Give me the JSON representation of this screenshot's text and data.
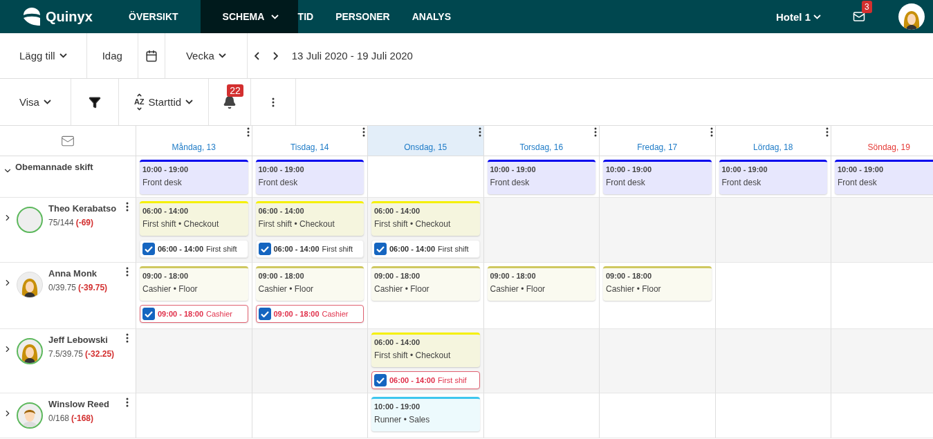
{
  "nav": {
    "logo": "Quinyx",
    "items": [
      {
        "label": "ÖVERSIKT",
        "selected": false,
        "dropdown": false
      },
      {
        "label": "SCHEMA",
        "selected": true,
        "dropdown": true
      },
      {
        "label": "TID",
        "selected": false,
        "dropdown": false
      },
      {
        "label": "PERSONER",
        "selected": false,
        "dropdown": false
      },
      {
        "label": "ANALYS",
        "selected": false,
        "dropdown": false
      }
    ],
    "unit": "Hotel 1",
    "mail_badge": "3"
  },
  "toolbar": {
    "add": "Lägg till",
    "today": "Idag",
    "period": "Vecka",
    "date_range": "13 Juli 2020 - 19 Juli 2020"
  },
  "filterbar": {
    "show": "Visa",
    "sort_icon": "AZ",
    "sort": "Starttid",
    "alerts_badge": "22"
  },
  "days": [
    {
      "label": "Måndag, 13",
      "selected": false,
      "kind": "weekday"
    },
    {
      "label": "Tisdag, 14",
      "selected": false,
      "kind": "weekday"
    },
    {
      "label": "Onsdag, 15",
      "selected": true,
      "kind": "weekday"
    },
    {
      "label": "Torsdag, 16",
      "selected": false,
      "kind": "weekday"
    },
    {
      "label": "Fredag, 17",
      "selected": false,
      "kind": "weekday"
    },
    {
      "label": "Lördag, 18",
      "selected": false,
      "kind": "weekday"
    },
    {
      "label": "Söndag, 19",
      "selected": false,
      "kind": "sunday"
    }
  ],
  "unassigned": {
    "label": "Obemannade skift",
    "expanded": true,
    "cells": [
      [
        {
          "kind": "shift",
          "time": "10:00 - 19:00",
          "title": "Front desk",
          "color": "#0000ee"
        }
      ],
      [
        {
          "kind": "shift",
          "time": "10:00 - 19:00",
          "title": "Front desk",
          "color": "#0000ee"
        }
      ],
      [],
      [
        {
          "kind": "shift",
          "time": "10:00 - 19:00",
          "title": "Front desk",
          "color": "#0000ee"
        }
      ],
      [
        {
          "kind": "shift",
          "time": "10:00 - 19:00",
          "title": "Front desk",
          "color": "#0000ee"
        }
      ],
      [
        {
          "kind": "shift",
          "time": "10:00 - 19:00",
          "title": "Front desk",
          "color": "#0000ee"
        }
      ],
      [
        {
          "kind": "shift",
          "time": "10:00 - 19:00",
          "title": "Front desk",
          "color": "#0000ee"
        }
      ]
    ]
  },
  "employees": [
    {
      "name": "Theo Kerabatso",
      "hours": "75/144",
      "diff": "(-69)",
      "avatar": {
        "kind": "blank",
        "ring": true
      },
      "cells": [
        [
          {
            "kind": "shift",
            "time": "06:00 - 14:00",
            "title": "First shift • Checkout",
            "color": "#f5f000"
          },
          {
            "kind": "task",
            "time": "06:00 - 14:00",
            "title": "First shift",
            "checked": true,
            "warning": false
          }
        ],
        [
          {
            "kind": "shift",
            "time": "06:00 - 14:00",
            "title": "First shift • Checkout",
            "color": "#f5f000"
          },
          {
            "kind": "task",
            "time": "06:00 - 14:00",
            "title": "First shift",
            "checked": true,
            "warning": false
          }
        ],
        [
          {
            "kind": "shift",
            "time": "06:00 - 14:00",
            "title": "First shift • Checkout",
            "color": "#f5f000"
          },
          {
            "kind": "task",
            "time": "06:00 - 14:00",
            "title": "First shift",
            "checked": true,
            "warning": false
          }
        ],
        [],
        [],
        [],
        []
      ]
    },
    {
      "name": "Anna Monk",
      "hours": "0/39.75",
      "diff": "(-39.75)",
      "avatar": {
        "kind": "female",
        "ring": false
      },
      "cells": [
        [
          {
            "kind": "shift",
            "time": "09:00 - 18:00",
            "title": "Cashier • Floor",
            "color": "#cfc860"
          },
          {
            "kind": "task",
            "time": "09:00 - 18:00",
            "title": "Cashier",
            "checked": true,
            "warning": true
          }
        ],
        [
          {
            "kind": "shift",
            "time": "09:00 - 18:00",
            "title": "Cashier • Floor",
            "color": "#cfc860"
          },
          {
            "kind": "task",
            "time": "09:00 - 18:00",
            "title": "Cashier",
            "checked": true,
            "warning": true
          }
        ],
        [
          {
            "kind": "shift",
            "time": "09:00 - 18:00",
            "title": "Cashier • Floor",
            "color": "#cfc860"
          }
        ],
        [
          {
            "kind": "shift",
            "time": "09:00 - 18:00",
            "title": "Cashier • Floor",
            "color": "#cfc860"
          }
        ],
        [
          {
            "kind": "shift",
            "time": "09:00 - 18:00",
            "title": "Cashier • Floor",
            "color": "#cfc860"
          }
        ],
        [],
        []
      ]
    },
    {
      "name": "Jeff Lebowski",
      "hours": "7.5/39.75",
      "diff": "(-32.25)",
      "avatar": {
        "kind": "female",
        "ring": true
      },
      "cells": [
        [],
        [],
        [
          {
            "kind": "shift",
            "time": "06:00 - 14:00",
            "title": "First shift • Checkout",
            "color": "#f5f000"
          },
          {
            "kind": "task",
            "time": "06:00 - 14:00",
            "title": "First shif",
            "checked": true,
            "warning": true
          }
        ],
        [],
        [],
        [],
        []
      ]
    },
    {
      "name": "Winslow Reed",
      "hours": "0/168",
      "diff": "(-168)",
      "avatar": {
        "kind": "male",
        "ring": true
      },
      "cells": [
        [],
        [],
        [
          {
            "kind": "shift",
            "time": "10:00 - 19:00",
            "title": "Runner • Sales",
            "color": "#3ec6ee"
          }
        ],
        [],
        [],
        [],
        []
      ]
    }
  ]
}
